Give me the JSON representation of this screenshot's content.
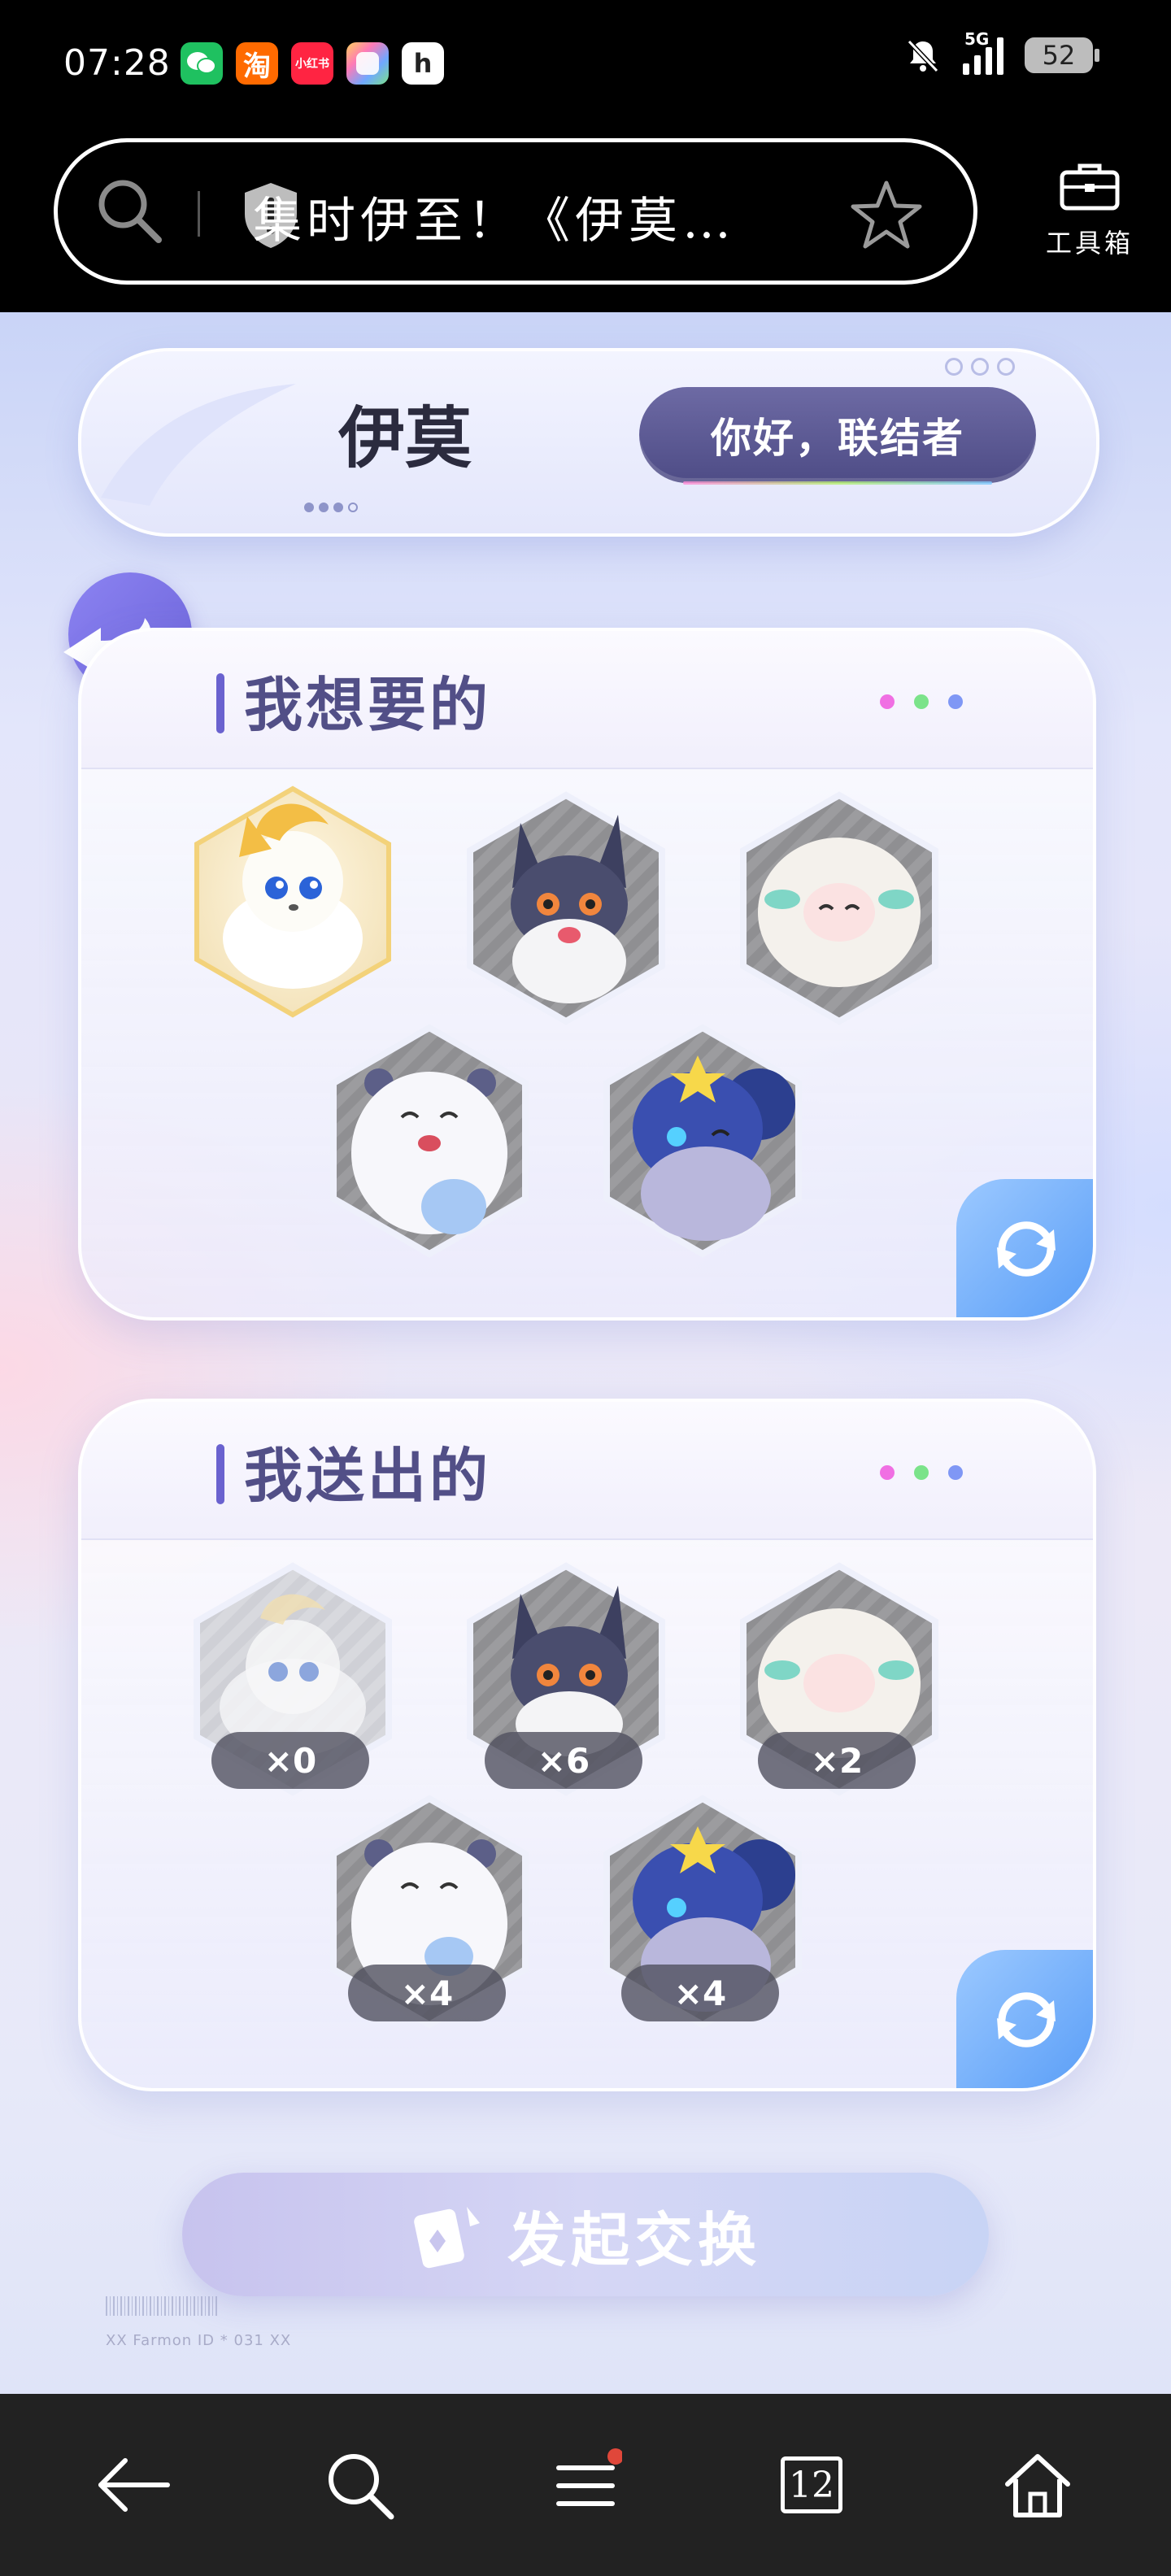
{
  "status_bar": {
    "time": "07:28",
    "network": "5G",
    "battery": "52",
    "apps": [
      {
        "name": "wechat-icon",
        "label": "",
        "color": "#1fc160"
      },
      {
        "name": "taobao-icon",
        "label": "淘",
        "color": "#ff6a00"
      },
      {
        "name": "xiaohongshu-icon",
        "label": "小红书",
        "color": "#ff2442"
      },
      {
        "name": "gallery-icon",
        "label": "",
        "color": "#7aa7ff"
      },
      {
        "name": "app-h-icon",
        "label": "h",
        "color": "#ffffff"
      }
    ]
  },
  "browser": {
    "url_title": "集时伊至！《伊莫…",
    "toolbox_label": "工具箱"
  },
  "header": {
    "logo_text": "伊莫",
    "greeting_button": "你好，联结者"
  },
  "wanted_panel": {
    "title": "我想要的",
    "items": [
      {
        "name": "creature-golden-fox",
        "selected": true
      },
      {
        "name": "creature-dark-fox",
        "selected": false
      },
      {
        "name": "creature-fluffy-sheep",
        "selected": false
      },
      {
        "name": "creature-white-bear",
        "selected": false
      },
      {
        "name": "creature-blue-squirrel",
        "selected": false
      }
    ]
  },
  "give_panel": {
    "title": "我送出的",
    "items": [
      {
        "name": "creature-golden-fox",
        "count": "×0"
      },
      {
        "name": "creature-dark-fox",
        "count": "×6"
      },
      {
        "name": "creature-fluffy-sheep",
        "count": "×2"
      },
      {
        "name": "creature-white-bear",
        "count": "×4"
      },
      {
        "name": "creature-blue-squirrel",
        "count": "×4"
      }
    ]
  },
  "exchange_button": "发起交换",
  "footer": {
    "meta": "XX Farmon ID * 031 XX"
  },
  "nav": {
    "tabs_count": "12"
  },
  "colors": {
    "accent": "#524f87",
    "greeting_bg": "#58558f",
    "refresh": "#6aa8f8",
    "back": "#7c74e8"
  }
}
